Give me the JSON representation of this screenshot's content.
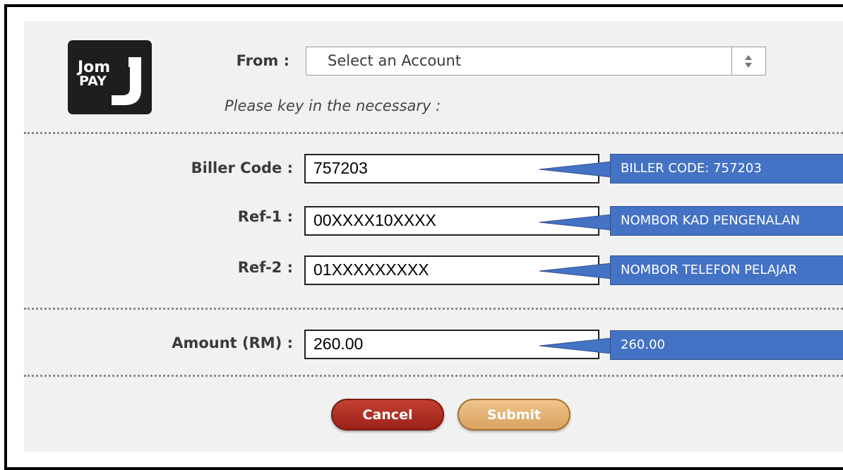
{
  "logo": {
    "line1": "Jom",
    "line2": "PAY",
    "mark": "J"
  },
  "from": {
    "label": "From :",
    "selected": "Select an Account"
  },
  "hint": "Please key in the necessary :",
  "fields": {
    "biller": {
      "label": "Biller Code :",
      "value": "757203",
      "callout": "BILLER CODE: 757203"
    },
    "ref1": {
      "label": "Ref-1 :",
      "value": "00XXXX10XXXX",
      "callout": "NOMBOR KAD PENGENALAN"
    },
    "ref2": {
      "label": "Ref-2 :",
      "value": "01XXXXXXXXX",
      "callout": "NOMBOR TELEFON PELAJAR"
    },
    "amount": {
      "label": "Amount (RM) :",
      "value": "260.00",
      "callout": "260.00"
    }
  },
  "buttons": {
    "cancel": "Cancel",
    "submit": "Submit"
  },
  "colors": {
    "callout": "#4472c4",
    "cancel": "#b0302a",
    "submit": "#e3b274"
  }
}
